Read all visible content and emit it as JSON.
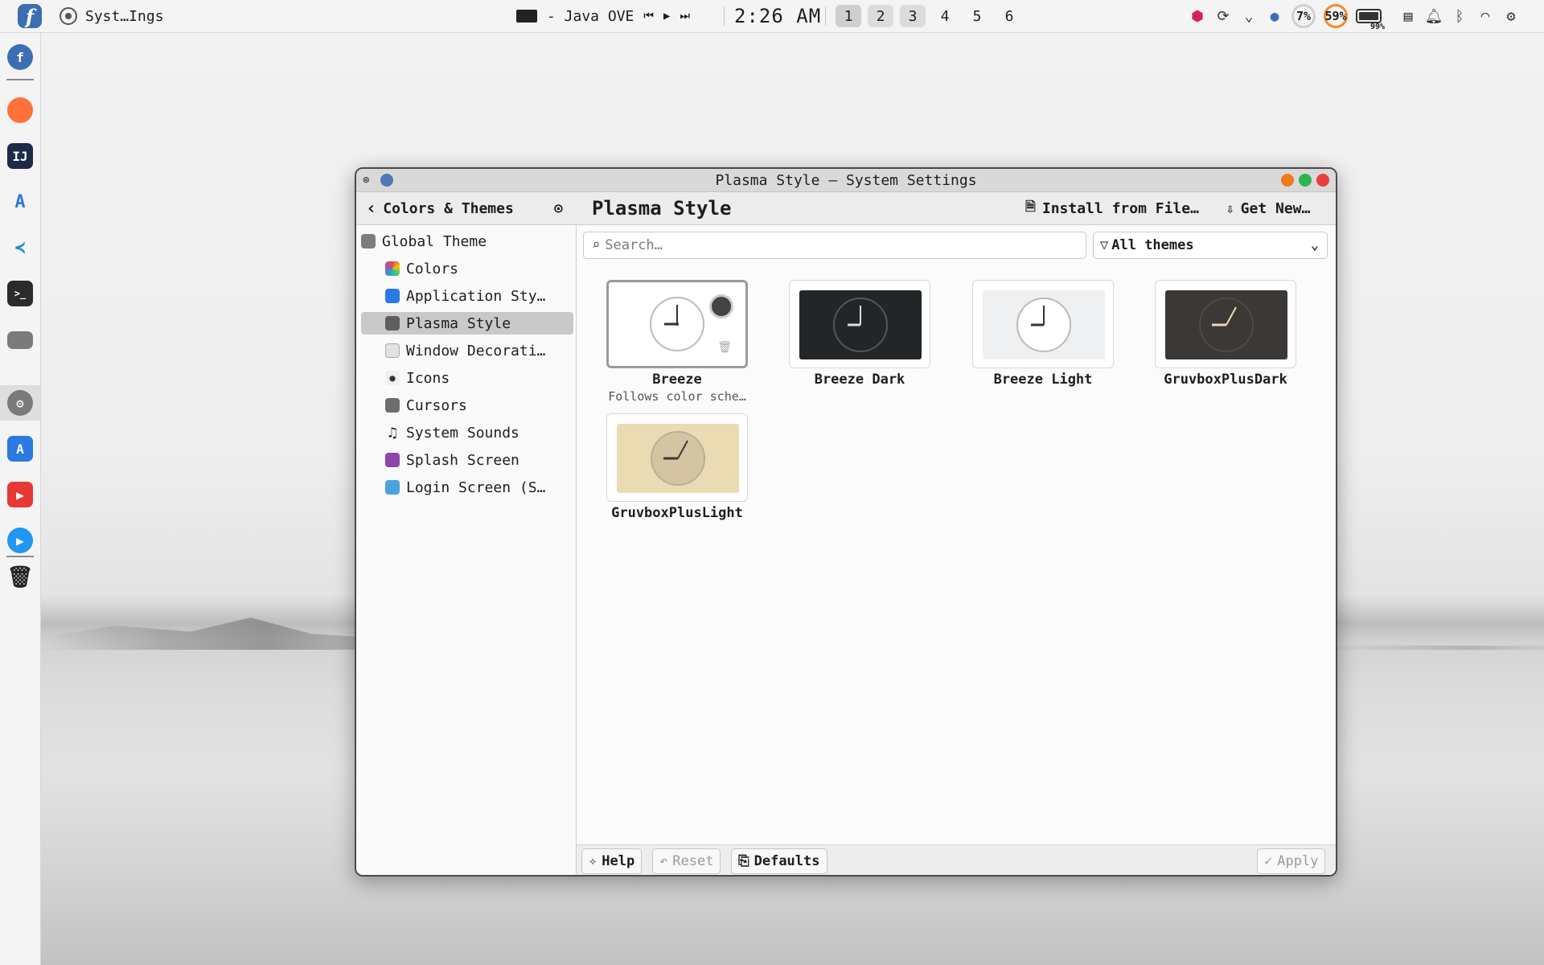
{
  "topbar": {
    "task_label": "Syst…Ings",
    "media_title": "- Java OVE",
    "clock": "2:26 AM",
    "desktops": [
      "1",
      "2",
      "3",
      "4",
      "5",
      "6"
    ],
    "cpu_percent": "7%",
    "mem_percent": "59%",
    "battery_percent": "99%"
  },
  "window": {
    "title": "Plasma Style — System Settings"
  },
  "toolbar": {
    "back_label": "Colors & Themes",
    "page_title": "Plasma Style",
    "install_label": "Install from File…",
    "get_new_label": "Get New…"
  },
  "sidebar": {
    "items": [
      {
        "label": "Global Theme"
      },
      {
        "label": "Colors"
      },
      {
        "label": "Application Sty…"
      },
      {
        "label": "Plasma Style"
      },
      {
        "label": "Window Decorati…"
      },
      {
        "label": "Icons"
      },
      {
        "label": "Cursors"
      },
      {
        "label": "System Sounds"
      },
      {
        "label": "Splash Screen"
      },
      {
        "label": "Login Screen (S…"
      }
    ]
  },
  "search": {
    "placeholder": "Search…"
  },
  "filter": {
    "value": "All themes"
  },
  "themes": [
    {
      "name": "Breeze",
      "subtitle": "Follows color sche…"
    },
    {
      "name": "Breeze Dark"
    },
    {
      "name": "Breeze Light"
    },
    {
      "name": "GruvboxPlusDark"
    },
    {
      "name": "GruvboxPlusLight"
    }
  ],
  "footer": {
    "help": "Help",
    "reset": "Reset",
    "defaults": "Defaults",
    "apply": "Apply"
  },
  "colors": {
    "accent": "#3c6eb4",
    "close": "#e9403c",
    "maximize": "#2fb34f",
    "minimize": "#f27a1f"
  }
}
